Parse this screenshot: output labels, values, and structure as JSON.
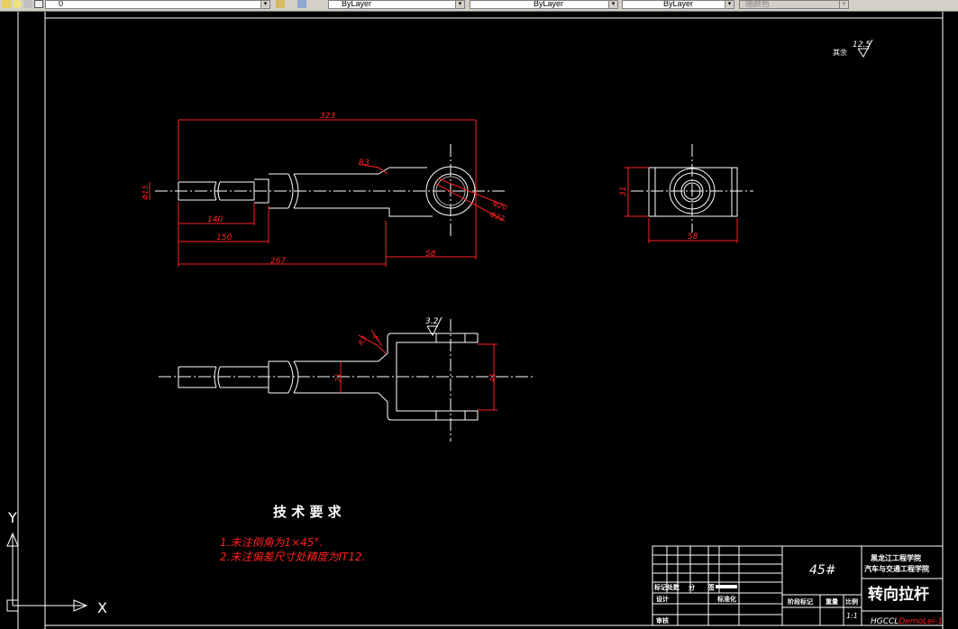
{
  "toolbar": {
    "layer_value": "0",
    "color_value": "ByLayer",
    "linetype_value": "ByLayer",
    "lineweight_value": "ByLayer",
    "plotstyle_value": "随颜色"
  },
  "drawing": {
    "roughness_note": "其余",
    "roughness_value": "12.5",
    "roughness_value_2": "3.2",
    "dims": {
      "d323": "323",
      "r3_top": "R3",
      "phi15": "Φ15",
      "phi20": "Φ20",
      "phi22": "Φ22",
      "d140": "140",
      "d150": "150",
      "d267": "267",
      "d58": "58",
      "d31": "31",
      "d58_side": "58",
      "r3_bottom": "R3",
      "d5": "5",
      "d21": "21",
      "d41": "41"
    },
    "tech_title": "技 术 要 求",
    "tech_items": [
      "1.未注倒角为1×45°.",
      "2.未注偏差尺寸处精度为IT12."
    ]
  },
  "title_block": {
    "material": "45#",
    "school": "黑龙江工程学院",
    "college": "汽车与交通工程学院",
    "part_name": "转向拉杆",
    "drawing_no": "HGCCL",
    "drawing_no_suffix": "DemoLei-1",
    "mark_label": "标记处数",
    "zone_label": "分",
    "sign_label": "签",
    "design_label": "设计",
    "std_label": "标准化",
    "review_label": "审核",
    "stage_label": "阶段标记",
    "weight_label": "重量",
    "scale_label": "比例",
    "scale_value": "1:1"
  },
  "ucs": {
    "x_label": "X",
    "y_label": "Y"
  }
}
